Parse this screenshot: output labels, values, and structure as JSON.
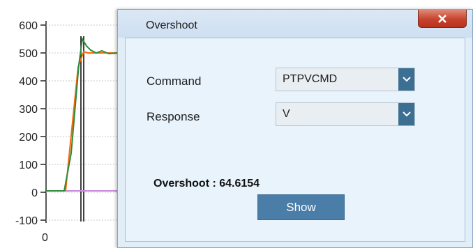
{
  "chart": {
    "y_ticks": [
      "600",
      "500",
      "400",
      "300",
      "200",
      "100",
      "0",
      "-100"
    ],
    "x_ticks": [
      "0"
    ]
  },
  "dialog": {
    "title": "Overshoot",
    "close_icon": "close-x-icon",
    "command_label": "Command",
    "command_value": "PTPVCMD",
    "response_label": "Response",
    "response_value": "V",
    "result_text": "Overshoot : 64.6154",
    "show_label": "Show"
  },
  "colors": {
    "command_trace": "#ff6600",
    "response_trace": "#2e8b3c",
    "zero_trace": "#cc88dd",
    "close_button": "#c7432d",
    "show_button": "#4a7ea8",
    "combo_arrow": "#3d6f92"
  }
}
